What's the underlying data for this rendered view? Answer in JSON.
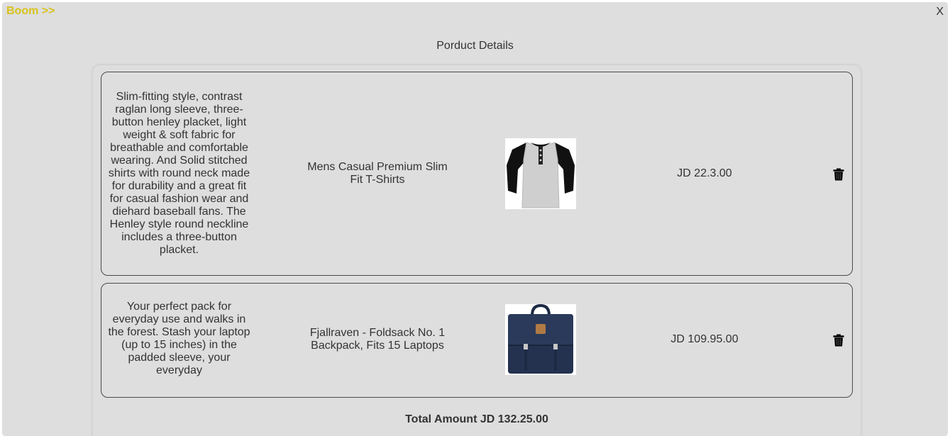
{
  "header": {
    "brand": "Boom >>",
    "close": "X"
  },
  "page": {
    "title": "Porduct Details"
  },
  "products": [
    {
      "description": "Slim-fitting style, contrast raglan long sleeve, three-button henley placket, light weight & soft fabric for breathable and comfortable wearing. And Solid stitched shirts with round neck made for durability and a great fit for casual fashion wear and diehard baseball fans. The Henley style round neckline includes a three-button placket.",
      "name": "Mens Casual Premium Slim Fit T-Shirts",
      "price": "JD 22.3.00",
      "image_icon": "henley-shirt-image",
      "delete_icon": "trash-icon"
    },
    {
      "description": "Your perfect pack for everyday use and walks in the forest. Stash your laptop (up to 15 inches) in the padded sleeve, your everyday",
      "name": "Fjallraven - Foldsack No. 1 Backpack, Fits 15 Laptops",
      "price": "JD 109.95.00",
      "image_icon": "backpack-image",
      "delete_icon": "trash-icon"
    }
  ],
  "summary": {
    "total": "Total Amount JD 132.25.00"
  },
  "colors": {
    "brand": "#d8c21a",
    "background": "#dedede",
    "border": "#4a4a4a"
  }
}
